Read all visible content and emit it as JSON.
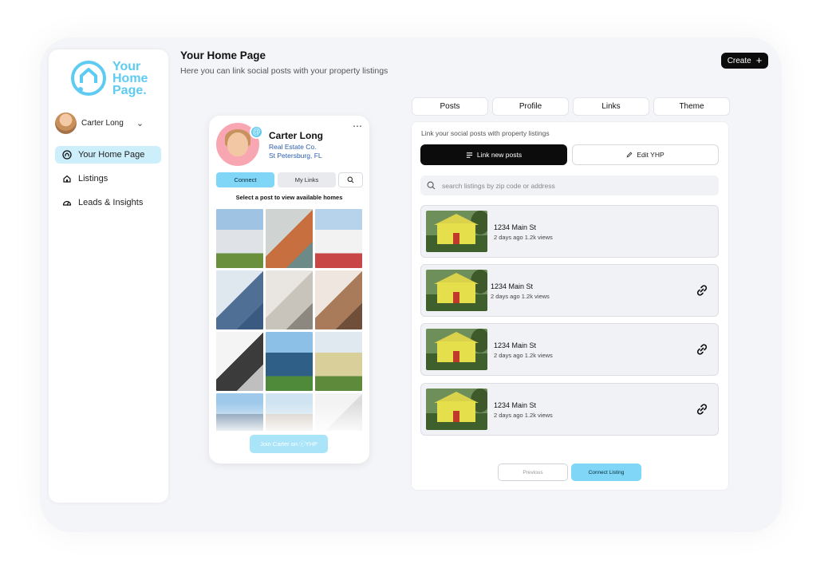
{
  "brand": {
    "logo_text_line1": "Your",
    "logo_text_line2": "Home",
    "logo_text_line3": "Page.",
    "accent": "#5ecbf2"
  },
  "user": {
    "name": "Carter Long"
  },
  "sidebar": {
    "items": [
      {
        "label": "Your Home Page",
        "icon": "home-icon",
        "active": true
      },
      {
        "label": "Listings",
        "icon": "house-icon",
        "active": false
      },
      {
        "label": "Leads & Insights",
        "icon": "gauge-icon",
        "active": false
      }
    ]
  },
  "header": {
    "title": "Your Home Page",
    "subtitle": "Here you can link social posts with your property listings",
    "create_label": "Create"
  },
  "phone": {
    "name": "Carter Long",
    "company": "Real Estate Co.",
    "location": "St Petersburg, FL",
    "connect_label": "Connect",
    "links_label": "My Links",
    "prompt": "Select a post to view available homes",
    "join_label": "Join Carter on ⓒYHP",
    "tiles": [
      {
        "kind": "exterior",
        "colors": [
          "#9fc3e3",
          "#dfe3e8",
          "#6a8f3d"
        ]
      },
      {
        "kind": "interior",
        "colors": [
          "#cfd4d2",
          "#c86f3f",
          "#6b8a88"
        ]
      },
      {
        "kind": "exterior",
        "colors": [
          "#b7d3ec",
          "#f2f2f2",
          "#c84646"
        ]
      },
      {
        "kind": "porch",
        "colors": [
          "#dfe8ee",
          "#4f6f95",
          "#3a5a82"
        ]
      },
      {
        "kind": "interior",
        "colors": [
          "#e9e6e1",
          "#c9c4bb",
          "#8c877f"
        ]
      },
      {
        "kind": "kitchen",
        "colors": [
          "#efe7df",
          "#a97b5a",
          "#6f4e3a"
        ]
      },
      {
        "kind": "kitchen",
        "colors": [
          "#f4f4f4",
          "#3b3b3b",
          "#bfbfbf"
        ]
      },
      {
        "kind": "exterior",
        "colors": [
          "#8cc0e6",
          "#2f5f86",
          "#4e8a3a"
        ]
      },
      {
        "kind": "exterior",
        "colors": [
          "#dfe9ef",
          "#d9cf9a",
          "#5e8a3b"
        ]
      },
      {
        "kind": "exterior",
        "colors": [
          "#9fc9ea",
          "#5f7f9e",
          "#3e6a3a"
        ]
      },
      {
        "kind": "exterior",
        "colors": [
          "#cfe3f1",
          "#cfc6bc",
          "#9a8f85"
        ]
      },
      {
        "kind": "interior",
        "colors": [
          "#f3f3f3",
          "#dcdcdc",
          "#c9c9c9"
        ]
      }
    ]
  },
  "tabs": [
    "Posts",
    "Profile",
    "Links",
    "Theme"
  ],
  "panel": {
    "note": "Link your social posts with property listings",
    "link_new_label": "Link new posts",
    "edit_label": "Edit YHP",
    "search_placeholder": "search listings by zip code or address",
    "listings": [
      {
        "address": "1234 Main St",
        "meta": "2 days ago 1.2k views",
        "linked": false
      },
      {
        "address": "1234 Main St",
        "meta": "2 days ago 1.2k views",
        "linked": true
      },
      {
        "address": "1234 Main St",
        "meta": "2 days ago 1.2k views",
        "linked": true
      },
      {
        "address": "1234 Main St",
        "meta": "2 days ago 1.2k views",
        "linked": true
      }
    ],
    "previous_label": "Previous",
    "connect_listing_label": "Connect Listing"
  }
}
